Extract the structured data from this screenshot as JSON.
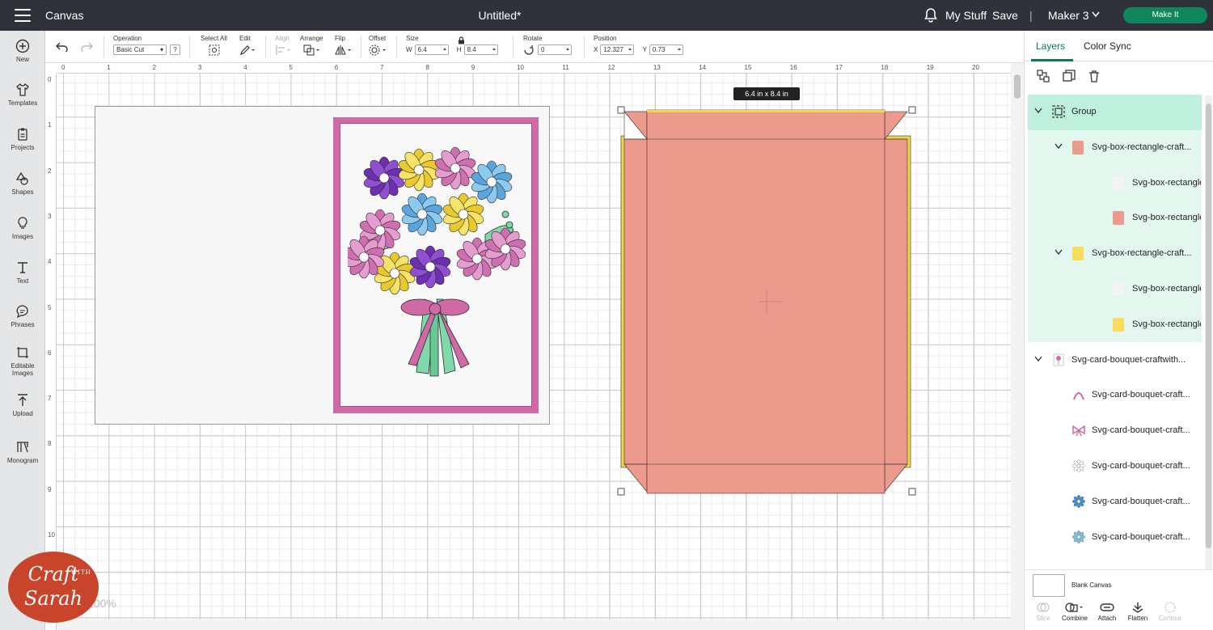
{
  "topbar": {
    "app_name": "Canvas",
    "doc_title": "Untitled*",
    "my_stuff": "My Stuff",
    "save": "Save",
    "separator": "|",
    "machine": "Maker 3",
    "make_it": "Make It"
  },
  "leftbar": {
    "items": [
      {
        "label": "New",
        "icon": "plus-circle-icon"
      },
      {
        "label": "Templates",
        "icon": "shirt-icon"
      },
      {
        "label": "Projects",
        "icon": "clipboard-icon"
      },
      {
        "label": "Shapes",
        "icon": "shapes-icon"
      },
      {
        "label": "Images",
        "icon": "bulb-icon"
      },
      {
        "label": "Text",
        "icon": "text-icon"
      },
      {
        "label": "Phrases",
        "icon": "speech-icon"
      },
      {
        "label": "Editable",
        "label2": "Images",
        "icon": "edit-image-icon"
      },
      {
        "label": "Upload",
        "icon": "upload-icon"
      },
      {
        "label": "Monogram",
        "icon": "monogram-icon"
      }
    ]
  },
  "toolbar": {
    "operation_label": "Operation",
    "operation_value": "Basic Cut",
    "help": "?",
    "select_all": "Select All",
    "edit": "Edit",
    "align": "Align",
    "arrange": "Arrange",
    "flip": "Flip",
    "offset": "Offset",
    "size": "Size",
    "w_label": "W",
    "w_value": "6.4",
    "h_label": "H",
    "h_value": "8.4",
    "rotate": "Rotate",
    "rotate_value": "0",
    "position": "Position",
    "x_label": "X",
    "x_value": "12.327",
    "y_label": "Y",
    "y_value": "0.73"
  },
  "ruler": {
    "top": [
      "0",
      "1",
      "2",
      "3",
      "4",
      "5",
      "6",
      "7",
      "8",
      "9",
      "10",
      "11",
      "12",
      "13",
      "14",
      "15",
      "16",
      "17",
      "18",
      "19",
      "20"
    ],
    "left": [
      "0",
      "1",
      "2",
      "3",
      "4",
      "5",
      "6",
      "7",
      "8",
      "9",
      "10"
    ]
  },
  "canvas": {
    "dim_tooltip": "6.4  in x 8.4  in",
    "zoom": "100%"
  },
  "rpanel": {
    "tabs": [
      "Layers",
      "Color Sync"
    ],
    "layers": [
      {
        "label": "Group",
        "indent": 0,
        "chevron": true,
        "icon": "group",
        "color": ""
      },
      {
        "label": "Svg-box-rectangle-craft...",
        "indent": 1,
        "chevron": true,
        "icon": "swatch",
        "color": "#ec9a8c"
      },
      {
        "label": "Svg-box-rectangle...",
        "indent": 2,
        "chevron": false,
        "icon": "swatch",
        "color": "#f4f4f4"
      },
      {
        "label": "Svg-box-rectangle...",
        "indent": 2,
        "chevron": false,
        "icon": "swatch",
        "color": "#ec9a8c"
      },
      {
        "label": "Svg-box-rectangle-craft...",
        "indent": 1,
        "chevron": true,
        "icon": "swatch",
        "color": "#f9dc5c"
      },
      {
        "label": "Svg-box-rectangle...",
        "indent": 2,
        "chevron": false,
        "icon": "swatch",
        "color": "#f4f4f4"
      },
      {
        "label": "Svg-box-rectangle...",
        "indent": 2,
        "chevron": false,
        "icon": "swatch",
        "color": "#f9dc5c"
      },
      {
        "label": "Svg-card-bouquet-craftwith...",
        "indent": 0,
        "chevron": true,
        "icon": "thumb",
        "color": ""
      },
      {
        "label": "Svg-card-bouquet-craft...",
        "indent": 1,
        "chevron": false,
        "icon": "arc",
        "color": "#d06aa7"
      },
      {
        "label": "Svg-card-bouquet-craft...",
        "indent": 1,
        "chevron": false,
        "icon": "bow",
        "color": "#d06aa7"
      },
      {
        "label": "Svg-card-bouquet-craft...",
        "indent": 1,
        "chevron": false,
        "icon": "flower",
        "color": "#ffffff"
      },
      {
        "label": "Svg-card-bouquet-craft...",
        "indent": 1,
        "chevron": false,
        "icon": "flower",
        "color": "#3b8fd0"
      },
      {
        "label": "Svg-card-bouquet-craft...",
        "indent": 1,
        "chevron": false,
        "icon": "flower",
        "color": "#7ec0e8"
      }
    ],
    "blank_canvas": "Blank Canvas",
    "bottom_tools": [
      "Slice",
      "Combine",
      "Attach",
      "Flatten",
      "Contour"
    ]
  },
  "logo": {
    "line1": "Craft",
    "with": "WITH",
    "line2": "Sarah"
  },
  "colors": {
    "accent": "#0d7a4a",
    "box_fill": "#ec9a8c",
    "box_outline": "#f0d64a",
    "card_frame": "#d06aa7"
  }
}
